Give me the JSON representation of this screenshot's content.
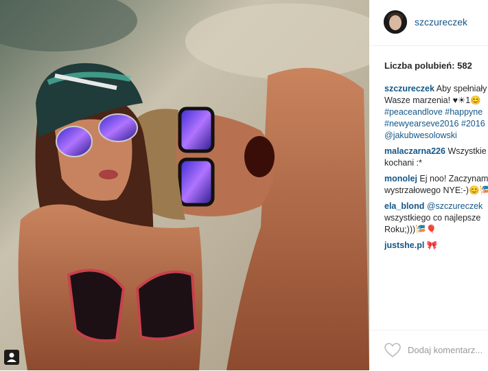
{
  "post": {
    "username": "szczureczek",
    "likes_text": "Liczba polubień: 582",
    "caption": {
      "user": "szczureczek",
      "lines": [
        "Aby spełniały",
        "Wasze marzenia! ♥☀1😊",
        "#peaceandlove #happyne",
        "#newyearseve2016 #2016",
        "@jakubwesolowski"
      ]
    },
    "comments": [
      {
        "user": "malaczarna226",
        "lines": [
          "Wszystkie",
          "kochani :*"
        ]
      },
      {
        "user": "monolej",
        "lines": [
          "Ej noo! Zaczynam",
          "wystrzałowego NYE:-)😊🎏"
        ]
      },
      {
        "user": "ela_blond",
        "lines": [
          "@szczureczek",
          "wszystkiego co najlepsze",
          "Roku;)))🎏🎈"
        ]
      },
      {
        "user": "justshe.pl",
        "lines": [
          "🎀"
        ]
      }
    ],
    "add_comment_placeholder": "Dodaj komentarz..."
  },
  "icons": {
    "heart": "heart-icon",
    "user_tag": "user-tag-icon"
  }
}
